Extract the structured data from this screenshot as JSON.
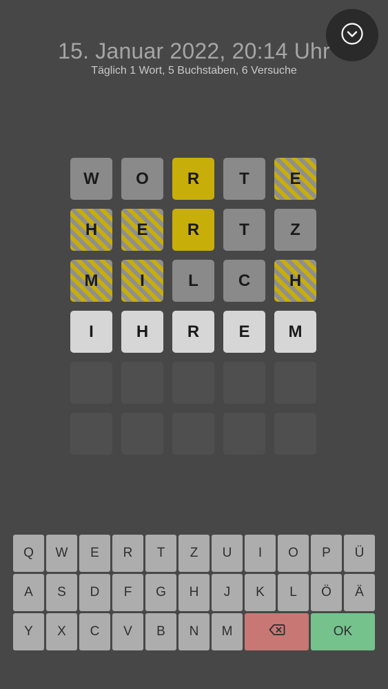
{
  "header": {
    "title": "15. Januar 2022, 20:14 Uhr",
    "subtitle": "Täglich 1 Wort, 5 Buchstaben, 6 Versuche"
  },
  "menu": {
    "icon": "chevron-down-circle-icon"
  },
  "colors": {
    "correct": "#c8ae09",
    "absent": "#8a8a8a",
    "present": "striped #c8ae09/#8f8f8f",
    "current": "#d6d6d6",
    "empty": "#4f4f4f",
    "background": "#474747"
  },
  "board": {
    "rows": [
      [
        {
          "letter": "W",
          "state": "absent"
        },
        {
          "letter": "O",
          "state": "absent"
        },
        {
          "letter": "R",
          "state": "correct"
        },
        {
          "letter": "T",
          "state": "absent"
        },
        {
          "letter": "E",
          "state": "present"
        }
      ],
      [
        {
          "letter": "H",
          "state": "present"
        },
        {
          "letter": "E",
          "state": "present"
        },
        {
          "letter": "R",
          "state": "correct"
        },
        {
          "letter": "T",
          "state": "absent"
        },
        {
          "letter": "Z",
          "state": "absent"
        }
      ],
      [
        {
          "letter": "M",
          "state": "present"
        },
        {
          "letter": "I",
          "state": "present"
        },
        {
          "letter": "L",
          "state": "absent"
        },
        {
          "letter": "C",
          "state": "absent"
        },
        {
          "letter": "H",
          "state": "present"
        }
      ],
      [
        {
          "letter": "I",
          "state": "current"
        },
        {
          "letter": "H",
          "state": "current"
        },
        {
          "letter": "R",
          "state": "current"
        },
        {
          "letter": "E",
          "state": "current"
        },
        {
          "letter": "M",
          "state": "current"
        }
      ],
      [
        {
          "letter": "",
          "state": "empty"
        },
        {
          "letter": "",
          "state": "empty"
        },
        {
          "letter": "",
          "state": "empty"
        },
        {
          "letter": "",
          "state": "empty"
        },
        {
          "letter": "",
          "state": "empty"
        }
      ],
      [
        {
          "letter": "",
          "state": "empty"
        },
        {
          "letter": "",
          "state": "empty"
        },
        {
          "letter": "",
          "state": "empty"
        },
        {
          "letter": "",
          "state": "empty"
        },
        {
          "letter": "",
          "state": "empty"
        }
      ]
    ]
  },
  "keyboard": {
    "rows": [
      [
        "Q",
        "W",
        "E",
        "R",
        "T",
        "Z",
        "U",
        "I",
        "O",
        "P",
        "Ü"
      ],
      [
        "A",
        "S",
        "D",
        "F",
        "G",
        "H",
        "J",
        "K",
        "L",
        "Ö",
        "Ä"
      ],
      [
        "Y",
        "X",
        "C",
        "V",
        "B",
        "N",
        "M"
      ]
    ],
    "backspace_icon": "backspace-icon",
    "ok_label": "OK"
  }
}
